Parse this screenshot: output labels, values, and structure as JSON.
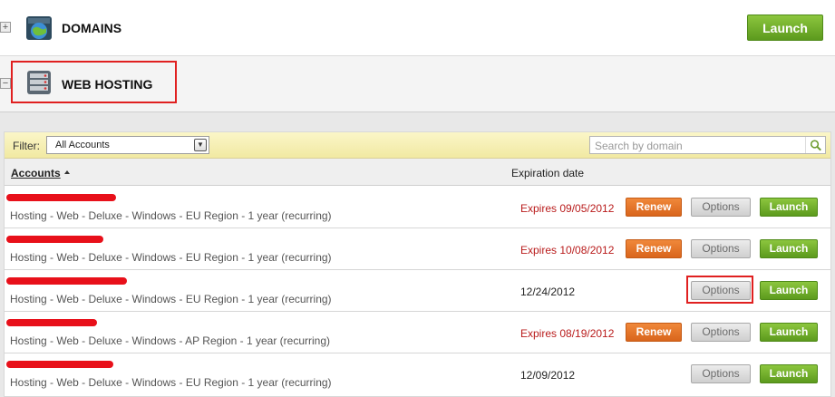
{
  "sections": {
    "domains": {
      "title": "DOMAINS",
      "expander": "+",
      "launch_label": "Launch"
    },
    "web_hosting": {
      "title": "WEB HOSTING",
      "expander": "−"
    }
  },
  "filter": {
    "label": "Filter:",
    "selected": "All Accounts",
    "search_placeholder": "Search by domain"
  },
  "table": {
    "col_accounts": "Accounts",
    "col_expiration": "Expiration date",
    "rows": [
      {
        "desc": "Hosting - Web - Deluxe - Windows - EU Region - 1 year (recurring)",
        "expiry": "Expires 09/05/2012",
        "status": "warn",
        "renew": "Renew",
        "options": "Options",
        "launch": "Launch"
      },
      {
        "desc": "Hosting - Web - Deluxe - Windows - EU Region - 1 year (recurring)",
        "expiry": "Expires 10/08/2012",
        "status": "warn",
        "renew": "Renew",
        "options": "Options",
        "launch": "Launch"
      },
      {
        "desc": "Hosting - Web - Deluxe - Windows - EU Region - 1 year (recurring)",
        "expiry": "12/24/2012",
        "status": "ok",
        "renew": "",
        "options": "Options",
        "launch": "Launch"
      },
      {
        "desc": "Hosting - Web - Deluxe - Windows - AP Region - 1 year (recurring)",
        "expiry": "Expires 08/19/2012",
        "status": "warn",
        "renew": "Renew",
        "options": "Options",
        "launch": "Launch"
      },
      {
        "desc": "Hosting - Web - Deluxe - Windows - EU Region - 1 year (recurring)",
        "expiry": "12/09/2012",
        "status": "ok",
        "renew": "",
        "options": "Options",
        "launch": "Launch"
      }
    ]
  },
  "colors": {
    "launch_green": "#6aab27",
    "renew_orange": "#e2702a",
    "expiry_red": "#b91c1c",
    "annotation_red": "#e02020",
    "filter_yellow": "#f4eeb4"
  }
}
